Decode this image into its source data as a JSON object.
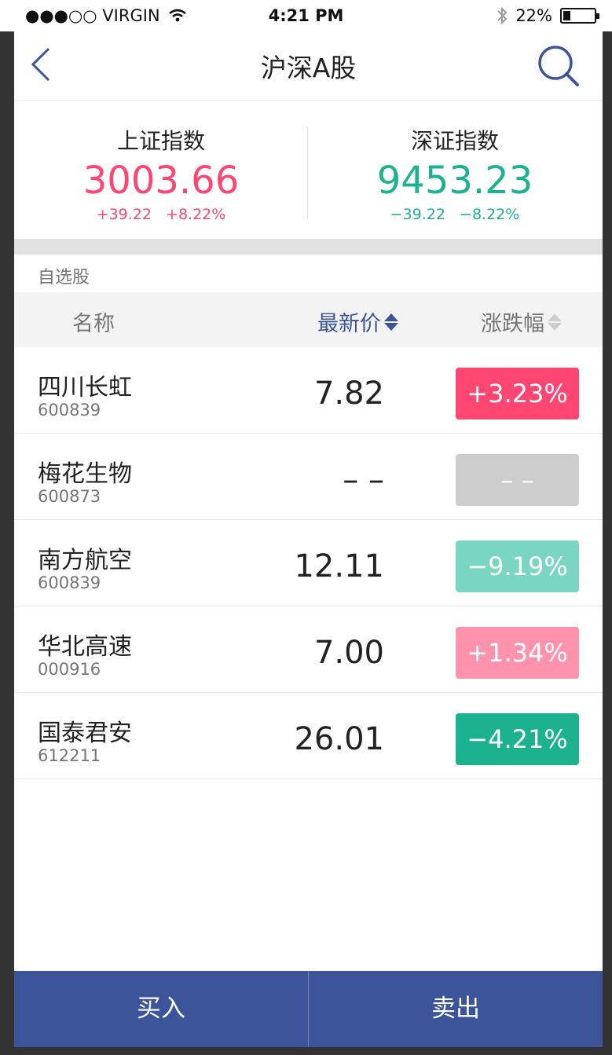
{
  "status_bar": {
    "carrier": "●●●○○ VIRGIN",
    "time": "4:21 PM",
    "battery": "22%",
    "battery_level": 0.22
  },
  "nav": {
    "title": "沪深A股",
    "back_icon": "chevron-left-icon",
    "search_icon": "search-icon"
  },
  "indices": [
    {
      "name": "上证指数",
      "value": "3003.66",
      "change": "+39.22",
      "percent": "+8.22%",
      "color": "#ff4672"
    },
    {
      "name": "深证指数",
      "value": "9453.23",
      "change": "−39.22",
      "percent": "−8.22%",
      "color": "#1cb290"
    }
  ],
  "watchlist": {
    "label": "自选股"
  },
  "columns": {
    "name": "名称",
    "price": "最新价",
    "change": "涨跌幅"
  },
  "stocks": [
    {
      "name": "四川长虹",
      "code": "600839",
      "price": "7.82",
      "change": "+3.23%",
      "color": "#ff4672"
    },
    {
      "name": "梅花生物",
      "code": "600873",
      "price": "– –",
      "change": "– –",
      "color": "#cdcdcd"
    },
    {
      "name": "南方航空",
      "code": "600839",
      "price": "12.11",
      "change": "−9.19%",
      "color": "#7bd6c1"
    },
    {
      "name": "华北高速",
      "code": "000916",
      "price": "7.00",
      "change": "+1.34%",
      "color": "#ff92ac"
    },
    {
      "name": "国泰君安",
      "code": "612211",
      "price": "26.01",
      "change": "−4.21%",
      "color": "#1cb290"
    }
  ],
  "actions": {
    "buy": "买入",
    "sell": "卖出"
  },
  "colors": {
    "brand": "#3c5499",
    "up": "#ff4672",
    "down": "#1cb290",
    "text": "#222222",
    "secondary": "#757575"
  }
}
